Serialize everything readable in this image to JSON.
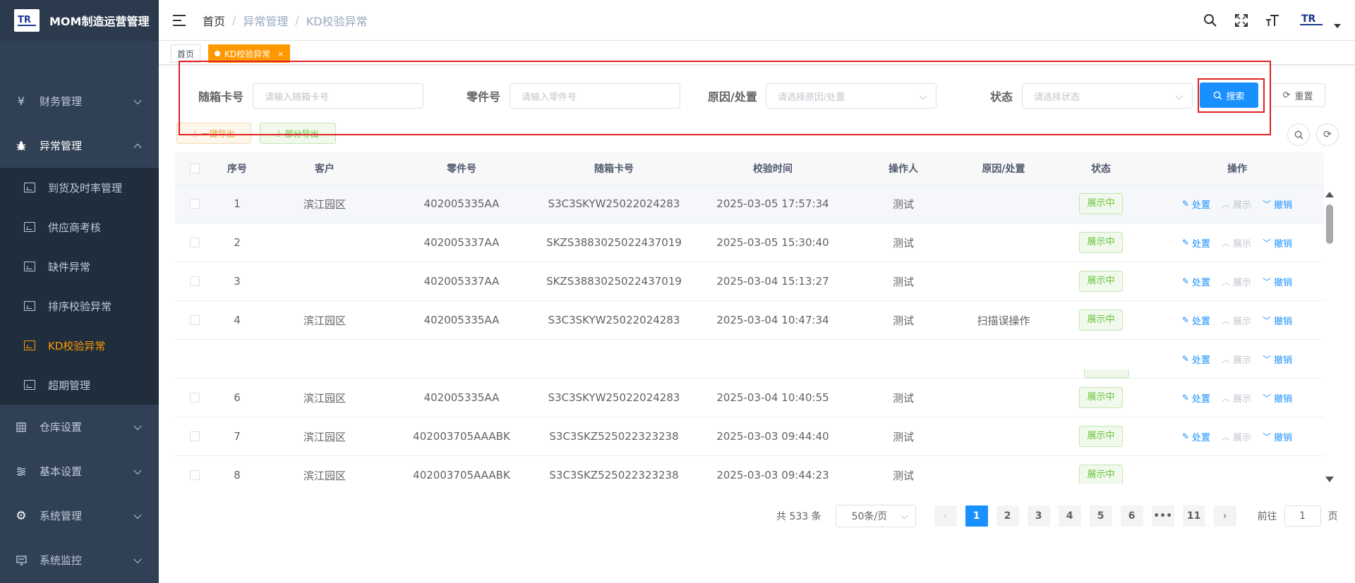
{
  "app": {
    "title": "MOM制造运营管理",
    "logo_text": "TR"
  },
  "sidebar": {
    "items": [
      {
        "label": "财务管理",
        "icon": "yen-icon"
      },
      {
        "label": "异常管理",
        "icon": "bug-icon",
        "open": true
      }
    ],
    "submenu": [
      {
        "label": "到货及时率管理"
      },
      {
        "label": "供应商考核"
      },
      {
        "label": "缺件异常"
      },
      {
        "label": "排序校验异常"
      },
      {
        "label": "KD校验异常",
        "active": true
      },
      {
        "label": "超期管理"
      }
    ],
    "items_after": [
      {
        "label": "仓库设置",
        "icon": "grid-icon"
      },
      {
        "label": "基本设置",
        "icon": "sliders-icon"
      },
      {
        "label": "系统管理",
        "icon": "gear-icon"
      },
      {
        "label": "系统监控",
        "icon": "monitor-icon"
      }
    ]
  },
  "header": {
    "breadcrumb": [
      "首页",
      "异常管理",
      "KD校验异常"
    ]
  },
  "tags": {
    "home": "首页",
    "current": "KD校验异常",
    "close": "×"
  },
  "search": {
    "fields": [
      {
        "label": "随箱卡号",
        "placeholder": "请输入随箱卡号"
      },
      {
        "label": "零件号",
        "placeholder": "请输入零件号"
      },
      {
        "label": "原因/处置",
        "placeholder": "请选择原因/处置"
      },
      {
        "label": "状态",
        "placeholder": "请选择状态"
      }
    ],
    "search_btn": "搜索",
    "reset_btn": "重置",
    "export_all": "一键导出",
    "export_part": "部分导出"
  },
  "table": {
    "columns": [
      "序号",
      "客户",
      "零件号",
      "随箱卡号",
      "校验时间",
      "操作人",
      "原因/处置",
      "状态",
      "操作"
    ],
    "rows": [
      {
        "no": "1",
        "customer": "滨江园区",
        "part": "402005335AA",
        "card": "S3C3SKYW25022024283",
        "time": "2025-03-05 17:57:34",
        "op": "测试",
        "reason": "",
        "status": "展示中"
      },
      {
        "no": "2",
        "customer": "",
        "part": "402005337AA",
        "card": "SKZS3883025022437019",
        "time": "2025-03-05 15:30:40",
        "op": "测试",
        "reason": "",
        "status": "展示中"
      },
      {
        "no": "3",
        "customer": "",
        "part": "402005337AA",
        "card": "SKZS3883025022437019",
        "time": "2025-03-04 15:13:27",
        "op": "测试",
        "reason": "",
        "status": "展示中"
      },
      {
        "no": "4",
        "customer": "滨江园区",
        "part": "402005335AA",
        "card": "S3C3SKYW25022024283",
        "time": "2025-03-04 10:47:34",
        "op": "测试",
        "reason": "扫描误操作",
        "status": "展示中"
      },
      {
        "no": "",
        "customer": "",
        "part": "",
        "card": "",
        "time": "",
        "op": "",
        "reason": "",
        "status": ""
      },
      {
        "no": "6",
        "customer": "滨江园区",
        "part": "402005335AA",
        "card": "S3C3SKYW25022024283",
        "time": "2025-03-04 10:40:55",
        "op": "测试",
        "reason": "",
        "status": "展示中"
      },
      {
        "no": "7",
        "customer": "滨江园区",
        "part": "402003705AAABK",
        "card": "S3C3SKZ525022323238",
        "time": "2025-03-03 09:44:40",
        "op": "测试",
        "reason": "",
        "status": "展示中"
      },
      {
        "no": "8",
        "customer": "滨江园区",
        "part": "402003705AAABK",
        "card": "S3C3SKZ525022323238",
        "time": "2025-03-03 09:44:23",
        "op": "测试",
        "reason": "",
        "status": "展示中"
      }
    ],
    "actions": {
      "handle": "处置",
      "show": "展示",
      "revoke": "撤销"
    }
  },
  "pager": {
    "total": "共 533 条",
    "size": "50条/页",
    "pages": [
      "1",
      "2",
      "3",
      "4",
      "5",
      "6",
      "•••",
      "11"
    ],
    "current": "1",
    "goto_label": "前往",
    "goto_value": "1",
    "goto_unit": "页"
  },
  "colors": {
    "accent": "#1890ff",
    "sidebar": "#304156",
    "active_menu": "#ff9800",
    "success": "#67c23a"
  }
}
